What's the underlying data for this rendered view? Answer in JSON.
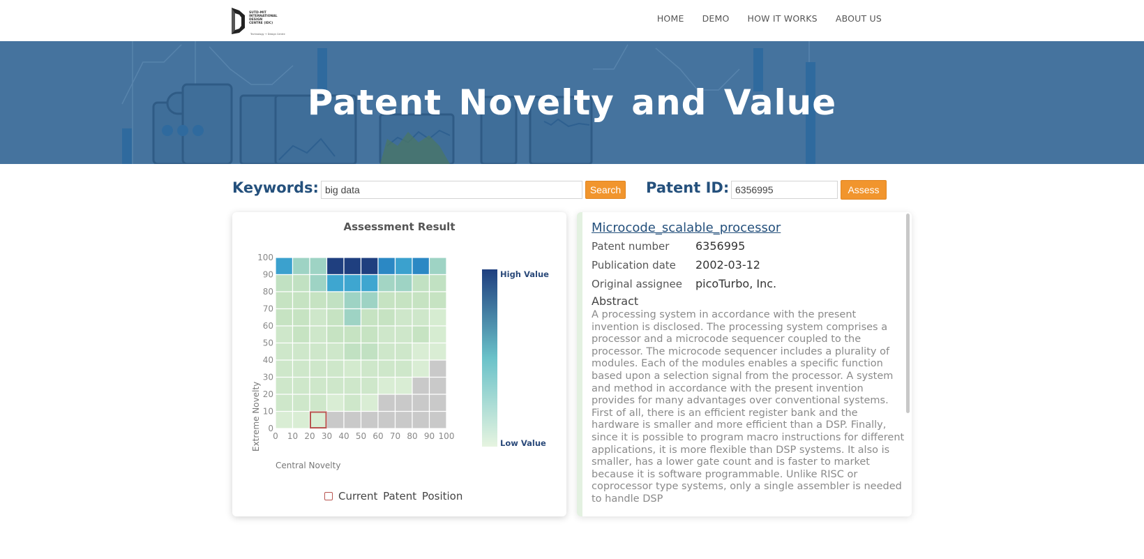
{
  "header": {
    "logo": {
      "lines": [
        "SUTD-MIT",
        "INTERNATIONAL",
        "DESIGN",
        "CENTRE (IDC)"
      ],
      "tagline": "Technology + Design Centre"
    },
    "nav": [
      "HOME",
      "DEMO",
      "HOW IT WORKS",
      "ABOUT US"
    ]
  },
  "hero": {
    "title": "Patent Novelty and Value"
  },
  "search": {
    "keywords_label": "Keywords:",
    "keywords_value": "big data",
    "search_button": "Search",
    "patent_id_label": "Patent ID:",
    "patent_id_value": "6356995",
    "assess_button": "Assess"
  },
  "assessment": {
    "title": "Assessment Result",
    "current_position_label": "Current  Patent  Position"
  },
  "colors": {
    "brand_blue": "#24507c",
    "hero_blue": "#45739e",
    "button_orange": "#f1952d",
    "marker_red": "#b85450",
    "na_gray": "#c9c9c9"
  },
  "chart_data": {
    "type": "heatmap",
    "title": "Assessment Result",
    "xlabel": "Central Novelty",
    "ylabel": "Extreme Novelty",
    "x_ticks": [
      "0",
      "10",
      "20",
      "30",
      "40",
      "50",
      "60",
      "70",
      "80",
      "90",
      "100"
    ],
    "y_ticks": [
      "0",
      "10",
      "20",
      "30",
      "40",
      "50",
      "60",
      "70",
      "80",
      "90",
      "100"
    ],
    "xlim": [
      0,
      100
    ],
    "ylim": [
      0,
      100
    ],
    "bin_size": 10,
    "colorbar": {
      "high_label": "High Value",
      "low_label": "Low Value",
      "high_color": "#1f3f7f",
      "mid_color": "#6ac2c9",
      "low_color": "#e6f4e0"
    },
    "missing_color": "#c9c9c9",
    "rows_top_to_bottom_y_start": [
      90,
      80,
      70,
      60,
      50,
      40,
      30,
      20,
      10,
      0
    ],
    "values": [
      [
        0.7,
        0.35,
        0.35,
        1.0,
        1.0,
        1.0,
        0.8,
        0.7,
        0.8,
        0.35
      ],
      [
        0.22,
        0.22,
        0.35,
        0.68,
        0.68,
        0.68,
        0.33,
        0.35,
        0.22,
        0.22
      ],
      [
        0.2,
        0.2,
        0.2,
        0.22,
        0.35,
        0.35,
        0.2,
        0.2,
        0.2,
        0.2
      ],
      [
        0.2,
        0.2,
        0.15,
        0.2,
        0.35,
        0.2,
        0.2,
        0.15,
        0.15,
        0.1
      ],
      [
        0.15,
        0.2,
        0.15,
        0.2,
        0.2,
        0.2,
        0.15,
        0.15,
        0.2,
        0.1
      ],
      [
        0.15,
        0.15,
        0.15,
        0.15,
        0.22,
        0.22,
        0.15,
        0.15,
        0.08,
        0.08
      ],
      [
        0.15,
        0.15,
        0.15,
        0.15,
        0.12,
        0.15,
        0.15,
        0.15,
        0.08,
        null
      ],
      [
        0.15,
        0.15,
        0.15,
        0.15,
        0.15,
        0.15,
        0.08,
        0.08,
        null,
        null
      ],
      [
        0.15,
        0.15,
        0.15,
        0.08,
        0.15,
        0.08,
        null,
        null,
        null,
        null
      ],
      [
        0.08,
        0.08,
        0.08,
        null,
        null,
        null,
        null,
        null,
        null,
        null
      ]
    ],
    "current_patent": {
      "central_novelty_bin": [
        20,
        30
      ],
      "extreme_novelty_bin": [
        0,
        10
      ]
    },
    "legend": "right"
  },
  "patent": {
    "title": "Microcode_scalable_processor",
    "fields": [
      {
        "key": "Patent number",
        "value": "6356995"
      },
      {
        "key": "Publication date",
        "value": "2002-03-12"
      },
      {
        "key": "Original assignee",
        "value": "picoTurbo, Inc."
      }
    ],
    "abstract_label": "Abstract",
    "abstract": "A processing system in accordance with the present invention is disclosed. The processing system comprises a processor and a microcode sequencer coupled to the processor. The microcode sequencer includes a plurality of modules. Each of the modules enables a specific function based upon a selection signal from the processor. A system and method in accordance with the present invention provides for many advantages over conventional systems. First of all, there is an efficient register bank and the hardware is smaller and more efficient than a DSP. Finally, since it is possible to program macro instructions for different applications, it is more flexible than DSP systems. It also is smaller, has a lower gate count and is faster to market because it is software programmable. Unlike RISC or coprocessor type systems, only a single assembler is needed to handle DSP"
  }
}
